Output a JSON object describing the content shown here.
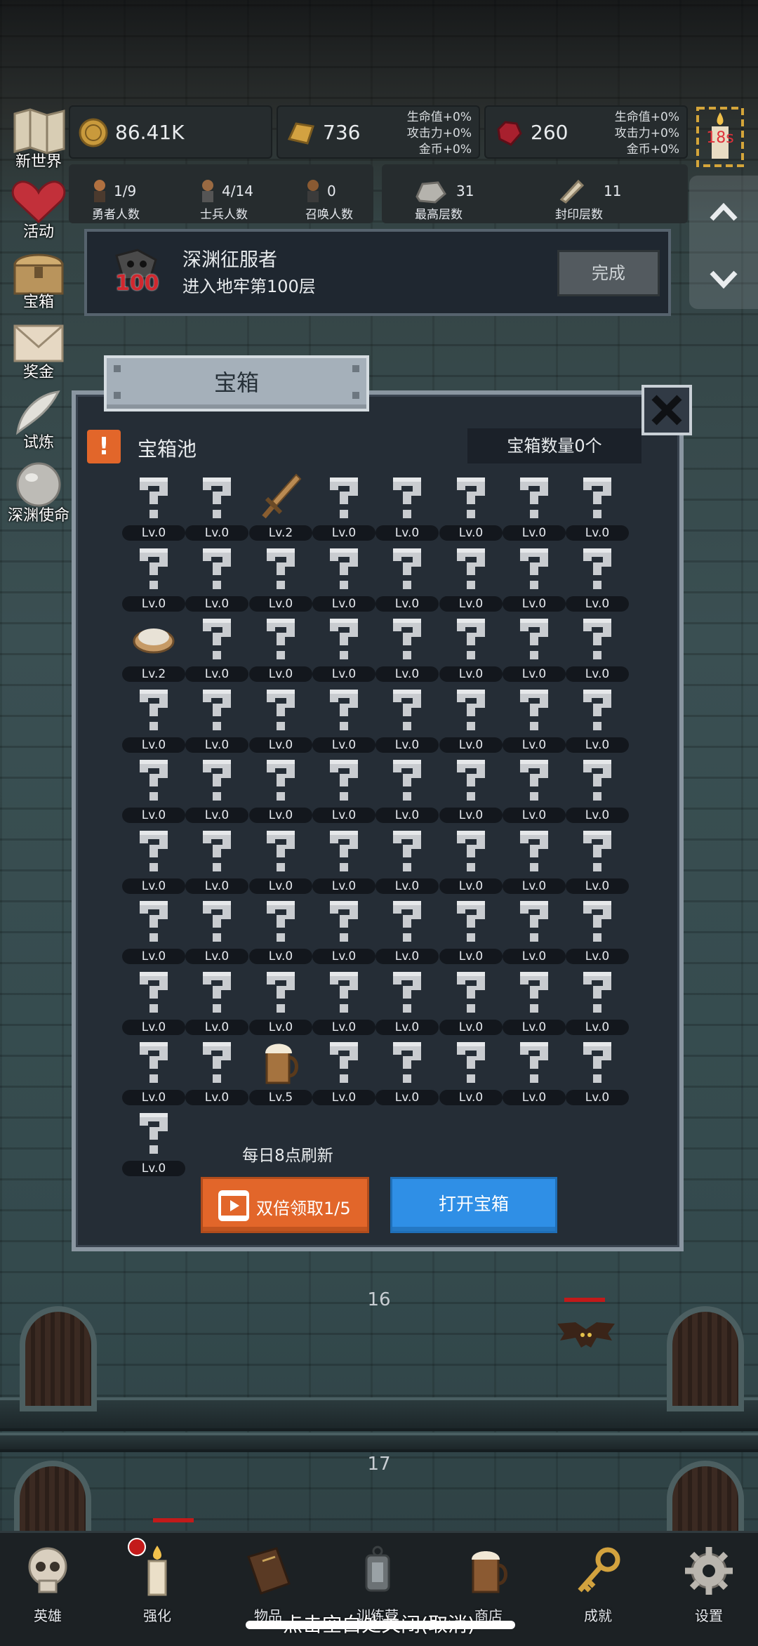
{
  "resources": {
    "gold": {
      "value": "86.41K"
    },
    "bar": {
      "value": "736",
      "bonus": [
        "生命值+0%",
        "攻击力+0%",
        "金币+0%"
      ]
    },
    "gem": {
      "value": "260",
      "bonus": [
        "生命值+0%",
        "攻击力+0%",
        "金币+0%"
      ]
    },
    "timer": "18s"
  },
  "stats": [
    {
      "num": "1/9",
      "label": "勇者人数"
    },
    {
      "num": "4/14",
      "label": "士兵人数"
    },
    {
      "num": "0",
      "label": "召唤人数"
    },
    {
      "num": "31",
      "label": "最高层数"
    },
    {
      "num": "11",
      "label": "封印层数"
    }
  ],
  "side_menu": [
    "新世界",
    "活动",
    "宝箱",
    "奖金",
    "试炼",
    "深渊使命"
  ],
  "quest": {
    "title": "深渊征服者",
    "desc": "进入地牢第100层",
    "button": "完成",
    "badge": "100"
  },
  "panel": {
    "title": "宝箱",
    "pool_label": "宝箱池",
    "chest_count": "宝箱数量0个",
    "refresh_note": "每日8点刷新",
    "double_button": "双倍领取1/5",
    "open_button": "打开宝箱",
    "items": [
      {
        "icon": "unknown-icon",
        "lv": "Lv.0"
      },
      {
        "icon": "unknown-icon",
        "lv": "Lv.0"
      },
      {
        "icon": "sword-icon",
        "lv": "Lv.2"
      },
      {
        "icon": "unknown-icon",
        "lv": "Lv.0"
      },
      {
        "icon": "unknown-icon",
        "lv": "Lv.0"
      },
      {
        "icon": "unknown-icon",
        "lv": "Lv.0"
      },
      {
        "icon": "unknown-icon",
        "lv": "Lv.0"
      },
      {
        "icon": "unknown-icon",
        "lv": "Lv.0"
      },
      {
        "icon": "unknown-icon",
        "lv": "Lv.0"
      },
      {
        "icon": "unknown-icon",
        "lv": "Lv.0"
      },
      {
        "icon": "unknown-icon",
        "lv": "Lv.0"
      },
      {
        "icon": "unknown-icon",
        "lv": "Lv.0"
      },
      {
        "icon": "unknown-icon",
        "lv": "Lv.0"
      },
      {
        "icon": "unknown-icon",
        "lv": "Lv.0"
      },
      {
        "icon": "unknown-icon",
        "lv": "Lv.0"
      },
      {
        "icon": "unknown-icon",
        "lv": "Lv.0"
      },
      {
        "icon": "bowl-icon",
        "lv": "Lv.2"
      },
      {
        "icon": "unknown-icon",
        "lv": "Lv.0"
      },
      {
        "icon": "unknown-icon",
        "lv": "Lv.0"
      },
      {
        "icon": "unknown-icon",
        "lv": "Lv.0"
      },
      {
        "icon": "unknown-icon",
        "lv": "Lv.0"
      },
      {
        "icon": "unknown-icon",
        "lv": "Lv.0"
      },
      {
        "icon": "unknown-icon",
        "lv": "Lv.0"
      },
      {
        "icon": "unknown-icon",
        "lv": "Lv.0"
      },
      {
        "icon": "unknown-icon",
        "lv": "Lv.0"
      },
      {
        "icon": "unknown-icon",
        "lv": "Lv.0"
      },
      {
        "icon": "unknown-icon",
        "lv": "Lv.0"
      },
      {
        "icon": "unknown-icon",
        "lv": "Lv.0"
      },
      {
        "icon": "unknown-icon",
        "lv": "Lv.0"
      },
      {
        "icon": "unknown-icon",
        "lv": "Lv.0"
      },
      {
        "icon": "unknown-icon",
        "lv": "Lv.0"
      },
      {
        "icon": "unknown-icon",
        "lv": "Lv.0"
      },
      {
        "icon": "unknown-icon",
        "lv": "Lv.0"
      },
      {
        "icon": "unknown-icon",
        "lv": "Lv.0"
      },
      {
        "icon": "unknown-icon",
        "lv": "Lv.0"
      },
      {
        "icon": "unknown-icon",
        "lv": "Lv.0"
      },
      {
        "icon": "unknown-icon",
        "lv": "Lv.0"
      },
      {
        "icon": "unknown-icon",
        "lv": "Lv.0"
      },
      {
        "icon": "unknown-icon",
        "lv": "Lv.0"
      },
      {
        "icon": "unknown-icon",
        "lv": "Lv.0"
      },
      {
        "icon": "unknown-icon",
        "lv": "Lv.0"
      },
      {
        "icon": "unknown-icon",
        "lv": "Lv.0"
      },
      {
        "icon": "unknown-icon",
        "lv": "Lv.0"
      },
      {
        "icon": "unknown-icon",
        "lv": "Lv.0"
      },
      {
        "icon": "unknown-icon",
        "lv": "Lv.0"
      },
      {
        "icon": "unknown-icon",
        "lv": "Lv.0"
      },
      {
        "icon": "unknown-icon",
        "lv": "Lv.0"
      },
      {
        "icon": "unknown-icon",
        "lv": "Lv.0"
      },
      {
        "icon": "unknown-icon",
        "lv": "Lv.0"
      },
      {
        "icon": "unknown-icon",
        "lv": "Lv.0"
      },
      {
        "icon": "unknown-icon",
        "lv": "Lv.0"
      },
      {
        "icon": "unknown-icon",
        "lv": "Lv.0"
      },
      {
        "icon": "unknown-icon",
        "lv": "Lv.0"
      },
      {
        "icon": "unknown-icon",
        "lv": "Lv.0"
      },
      {
        "icon": "unknown-icon",
        "lv": "Lv.0"
      },
      {
        "icon": "unknown-icon",
        "lv": "Lv.0"
      },
      {
        "icon": "unknown-icon",
        "lv": "Lv.0"
      },
      {
        "icon": "unknown-icon",
        "lv": "Lv.0"
      },
      {
        "icon": "unknown-icon",
        "lv": "Lv.0"
      },
      {
        "icon": "unknown-icon",
        "lv": "Lv.0"
      },
      {
        "icon": "unknown-icon",
        "lv": "Lv.0"
      },
      {
        "icon": "unknown-icon",
        "lv": "Lv.0"
      },
      {
        "icon": "unknown-icon",
        "lv": "Lv.0"
      },
      {
        "icon": "unknown-icon",
        "lv": "Lv.0"
      },
      {
        "icon": "unknown-icon",
        "lv": "Lv.0"
      },
      {
        "icon": "unknown-icon",
        "lv": "Lv.0"
      },
      {
        "icon": "beer-mug-icon",
        "lv": "Lv.5"
      },
      {
        "icon": "unknown-icon",
        "lv": "Lv.0"
      },
      {
        "icon": "unknown-icon",
        "lv": "Lv.0"
      },
      {
        "icon": "unknown-icon",
        "lv": "Lv.0"
      },
      {
        "icon": "unknown-icon",
        "lv": "Lv.0"
      },
      {
        "icon": "unknown-icon",
        "lv": "Lv.0"
      },
      {
        "icon": "unknown-icon",
        "lv": "Lv.0"
      }
    ]
  },
  "floors": [
    "16",
    "17"
  ],
  "bottom_nav": [
    "英雄",
    "强化",
    "物品",
    "训练营",
    "商店",
    "成就",
    "设置"
  ],
  "hint": "点击空白处关闭(取消)",
  "colors": {
    "orange": "#e2662a",
    "blue": "#2f8fe6",
    "panel": "#252d36"
  }
}
